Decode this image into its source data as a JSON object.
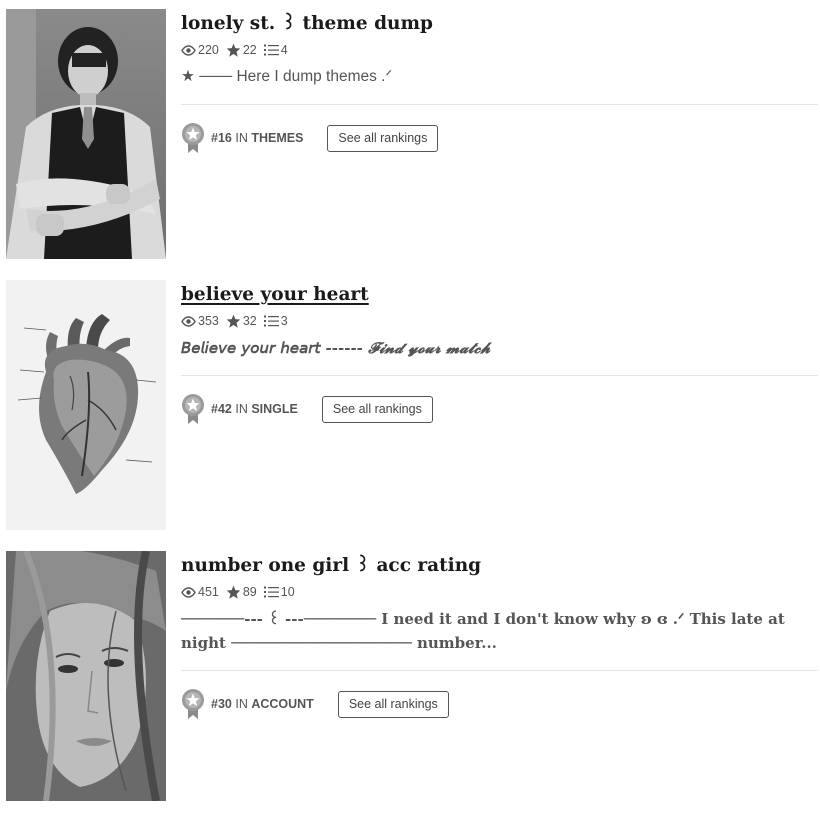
{
  "stories": [
    {
      "title": "lonely st. ꒱ theme dump",
      "reads": "220",
      "votes": "22",
      "parts": "4",
      "description": "★ ─── Here I dump themes .ᐟ",
      "rank_number": "#16",
      "rank_in": "IN",
      "rank_category": "THEMES",
      "rankings_button": "See all rankings",
      "cover_icon": "portrait-man-vest"
    },
    {
      "title": "believe your heart",
      "reads": "353",
      "votes": "32",
      "parts": "3",
      "description": "𝘉𝘦𝘭𝘪𝘦𝘷𝘦 𝘺𝘰𝘶𝘳 𝘩𝘦𝘢𝘳𝘵 ------ 𝓕𝓲𝓷𝓭 𝔂𝓸𝓾𝓻 𝓶𝓪𝓽𝓬𝓱",
      "rank_number": "#42",
      "rank_in": "IN",
      "rank_category": "SINGLE",
      "rankings_button": "See all rankings",
      "cover_icon": "anatomical-heart"
    },
    {
      "title": "number one girl ꒱ acc rating",
      "reads": "451",
      "votes": "89",
      "parts": "10",
      "description": "───────--- ꒰ ---──────── I need it and I don't know why ʚ ɞ .ᐟ This late at night ──────────────────── number...",
      "rank_number": "#30",
      "rank_in": "IN",
      "rank_category": "ACCOUNT",
      "rankings_button": "See all rankings",
      "cover_icon": "portrait-woman"
    }
  ],
  "icons": {
    "reads": "eye-icon",
    "votes": "star-icon",
    "parts": "list-icon",
    "medal": "ranking-medal-icon"
  },
  "colors": {
    "text": "#222222",
    "meta": "#555555",
    "divider": "#e4e4e4"
  }
}
